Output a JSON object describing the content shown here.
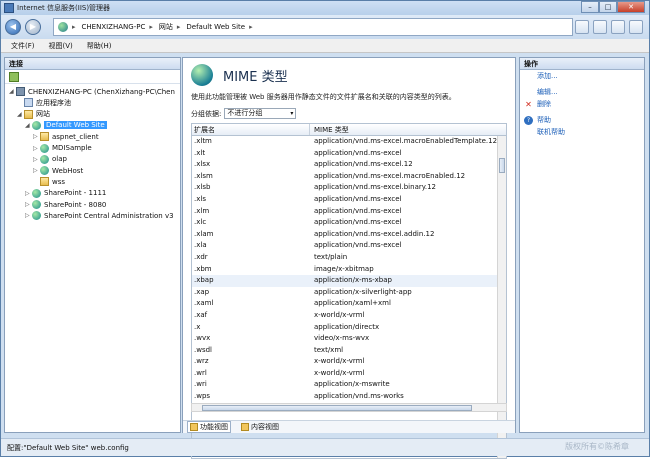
{
  "window": {
    "title": "Internet 信息服务(IIS)管理器",
    "min": "–",
    "max": "□",
    "close": "✕"
  },
  "address": {
    "back": "◀",
    "forward": "▶",
    "crumbs": [
      "CHENXIZHANG-PC",
      "网站",
      "Default Web Site"
    ],
    "separator": "▸"
  },
  "menu": {
    "file": "文件(F)",
    "view": "视图(V)",
    "help": "帮助(H)"
  },
  "connections": {
    "title": "连接",
    "nodes": [
      {
        "label": "CHENXIZHANG-PC (ChenXizhang-PC\\Chen",
        "icon": "pc",
        "toggle": "◢"
      },
      {
        "label": "应用程序池",
        "icon": "app",
        "toggle": ""
      },
      {
        "label": "网站",
        "icon": "folder",
        "toggle": "◢"
      },
      {
        "label": "Default Web Site",
        "icon": "globe",
        "toggle": "◢",
        "selected": true
      },
      {
        "label": "aspnet_client",
        "icon": "folder",
        "toggle": "▷"
      },
      {
        "label": "MDISample",
        "icon": "globe",
        "toggle": "▷"
      },
      {
        "label": "olap",
        "icon": "globe",
        "toggle": "▷"
      },
      {
        "label": "WebHost",
        "icon": "globe",
        "toggle": "▷"
      },
      {
        "label": "wss",
        "icon": "folder",
        "toggle": ""
      },
      {
        "label": "SharePoint - 1111",
        "icon": "globe",
        "toggle": "▷"
      },
      {
        "label": "SharePoint - 8080",
        "icon": "globe",
        "toggle": "▷"
      },
      {
        "label": "SharePoint Central Administration v3",
        "icon": "globe",
        "toggle": "▷"
      }
    ]
  },
  "main": {
    "title": "MIME 类型",
    "description": "使用此功能管理被 Web 服务器用作静态文件的文件扩展名和关联的内容类型的列表。",
    "group_label": "分组依据:",
    "group_value": "不进行分组",
    "columns": [
      "扩展名",
      "MIME 类型"
    ],
    "rows": [
      [
        ".xltm",
        "application/vnd.ms-excel.macroEnabledTemplate.12"
      ],
      [
        ".xlt",
        "application/vnd.ms-excel"
      ],
      [
        ".xlsx",
        "application/vnd.ms-excel.12"
      ],
      [
        ".xlsm",
        "application/vnd.ms-excel.macroEnabled.12"
      ],
      [
        ".xlsb",
        "application/vnd.ms-excel.binary.12"
      ],
      [
        ".xls",
        "application/vnd.ms-excel"
      ],
      [
        ".xlm",
        "application/vnd.ms-excel"
      ],
      [
        ".xlc",
        "application/vnd.ms-excel"
      ],
      [
        ".xlam",
        "application/vnd.ms-excel.addin.12"
      ],
      [
        ".xla",
        "application/vnd.ms-excel"
      ],
      [
        ".xdr",
        "text/plain"
      ],
      [
        ".xbm",
        "image/x-xbitmap"
      ],
      [
        ".xbap",
        "application/x-ms-xbap"
      ],
      [
        ".xap",
        "application/x-silverlight-app"
      ],
      [
        ".xaml",
        "application/xaml+xml"
      ],
      [
        ".xaf",
        "x-world/x-vrml"
      ],
      [
        ".x",
        "application/directx"
      ],
      [
        ".wvx",
        "video/x-ms-wvx"
      ],
      [
        ".wsdl",
        "text/xml"
      ],
      [
        ".wrz",
        "x-world/x-vrml"
      ],
      [
        ".wrl",
        "x-world/x-vrml"
      ],
      [
        ".wri",
        "application/x-mswrite"
      ],
      [
        ".wps",
        "application/vnd.ms-works"
      ]
    ],
    "selected_row": 12,
    "views": [
      "功能视图",
      "内容视图"
    ]
  },
  "actions": {
    "title": "操作",
    "items": [
      {
        "label": "添加...",
        "icon": "blank"
      },
      {
        "label": "编辑...",
        "icon": "blank"
      },
      {
        "label": "删除",
        "icon": "x",
        "glyph": "✕"
      },
      {
        "label": "帮助",
        "icon": "q",
        "glyph": "?"
      },
      {
        "label": "联机帮助",
        "icon": "blank"
      }
    ]
  },
  "status": {
    "text": "配置:\"Default Web Site\" web.config",
    "watermark": "版权所有©陈希章"
  }
}
